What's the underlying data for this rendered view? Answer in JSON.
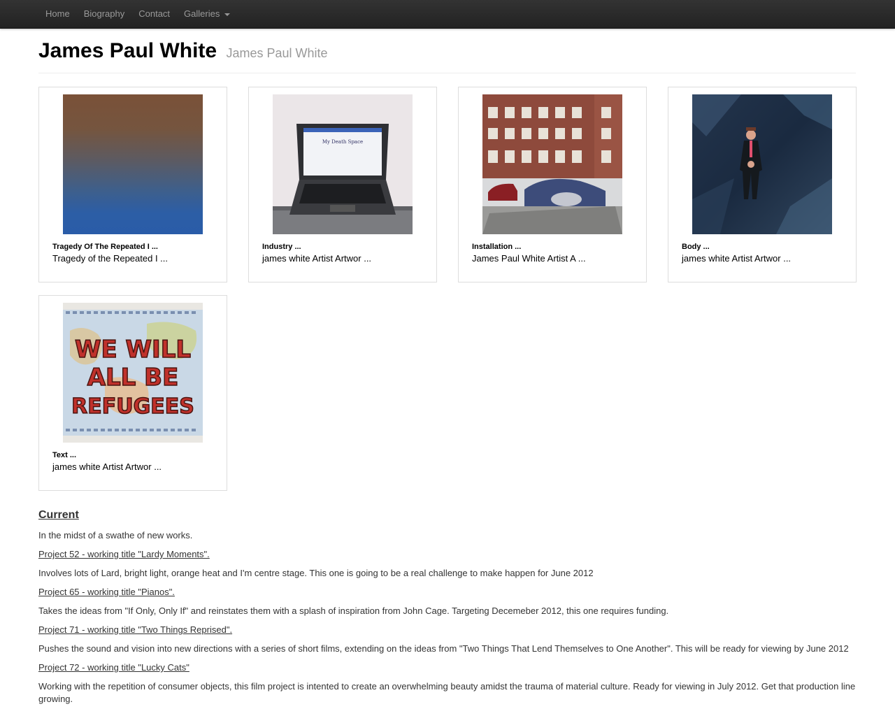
{
  "nav": {
    "home": "Home",
    "biography": "Biography",
    "contact": "Contact",
    "galleries": "Galleries"
  },
  "header": {
    "title": "James Paul White",
    "subtitle": "James Paul White"
  },
  "galleries": [
    {
      "title": "Tragedy Of The Repeated I ...",
      "desc": "Tragedy of the Repeated I ..."
    },
    {
      "title": "Industry ...",
      "desc": "james white Artist Artwor ..."
    },
    {
      "title": "Installation ...",
      "desc": "James Paul White Artist A ..."
    },
    {
      "title": "Body ...",
      "desc": "james white Artist Artwor ..."
    },
    {
      "title": "Text ...",
      "desc": "james white Artist Artwor ..."
    }
  ],
  "artwork": {
    "laptop_screen": "My Death Space",
    "refugees_lines": [
      "WE WILL",
      "ALL BE",
      "REFUGEES"
    ]
  },
  "current": {
    "heading": "Current",
    "intro": "In the midst of a swathe of new works.",
    "projects": [
      {
        "link": "Project 52 - working title \"Lardy Moments\".",
        "text": "Involves lots of Lard, bright light, orange heat and I'm centre stage. This one is going to be a real challenge to make happen for June 2012"
      },
      {
        "link": "Project 65 - working title \"Pianos\".",
        "text": "Takes the ideas from \"If Only, Only If\" and reinstates them with a splash of inspiration from John Cage. Targeting Decemeber 2012, this one requires funding."
      },
      {
        "link": "Project 71 - working title \"Two Things Reprised\".",
        "text": "Pushes the sound and vision into new directions with a series of short films, extending on the ideas from \"Two Things That Lend Themselves to One Another\". This will be ready for viewing by June 2012"
      },
      {
        "link": "Project 72 - working title \"Lucky Cats\" ",
        "text": "Working with the repetition of consumer objects, this film project is intented to create an overwhelming beauty amidst the trauma of material culture. Ready for viewing in July 2012. Get that production line growing."
      }
    ]
  }
}
